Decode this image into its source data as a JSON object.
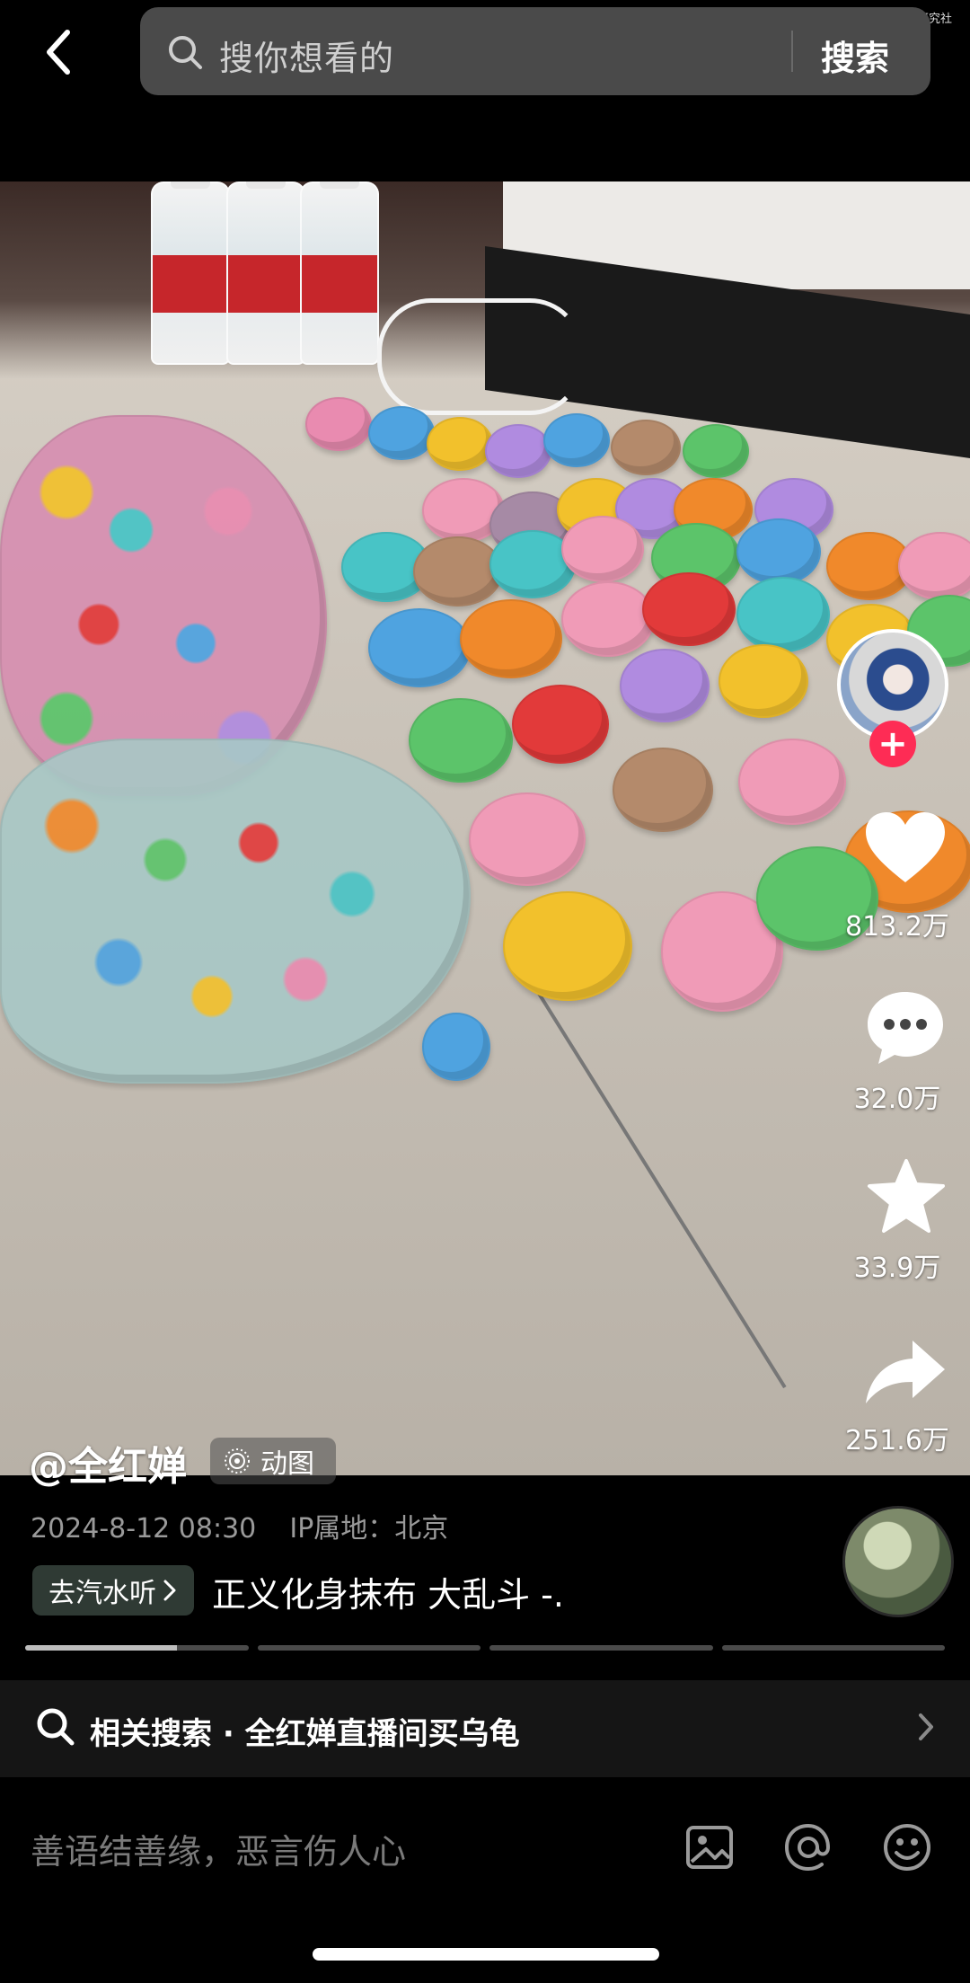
{
  "watermark": "@微信公众号：运营研究社",
  "search": {
    "placeholder": "搜你想看的",
    "button_label": "搜索"
  },
  "post": {
    "author": "@全红婵",
    "tag": "动图",
    "timestamp": "2024-8-12 08:30",
    "ip_location": "IP属地：北京",
    "music_chip": "去汽水听",
    "description": "正义化身抹布 大乱斗 -.",
    "progress_segments": 4,
    "progress_fill_first": 0.68
  },
  "actions": {
    "likes": "813.2万",
    "comments": "32.0万",
    "favorites": "33.9万",
    "shares": "251.6万"
  },
  "related_search": {
    "label": "相关搜索 · 全红婵直播间买乌龟"
  },
  "comment_bar": {
    "placeholder": "善语结善缘，恶言伤人心"
  },
  "icons": [
    "back-icon",
    "search-icon",
    "heart-icon",
    "comment-icon",
    "star-icon",
    "share-icon",
    "image-icon",
    "at-icon",
    "emoji-icon",
    "chevron-right-icon"
  ],
  "colors": {
    "accent": "#fe2c55",
    "background": "#000000",
    "chip": "#2f3a34"
  }
}
